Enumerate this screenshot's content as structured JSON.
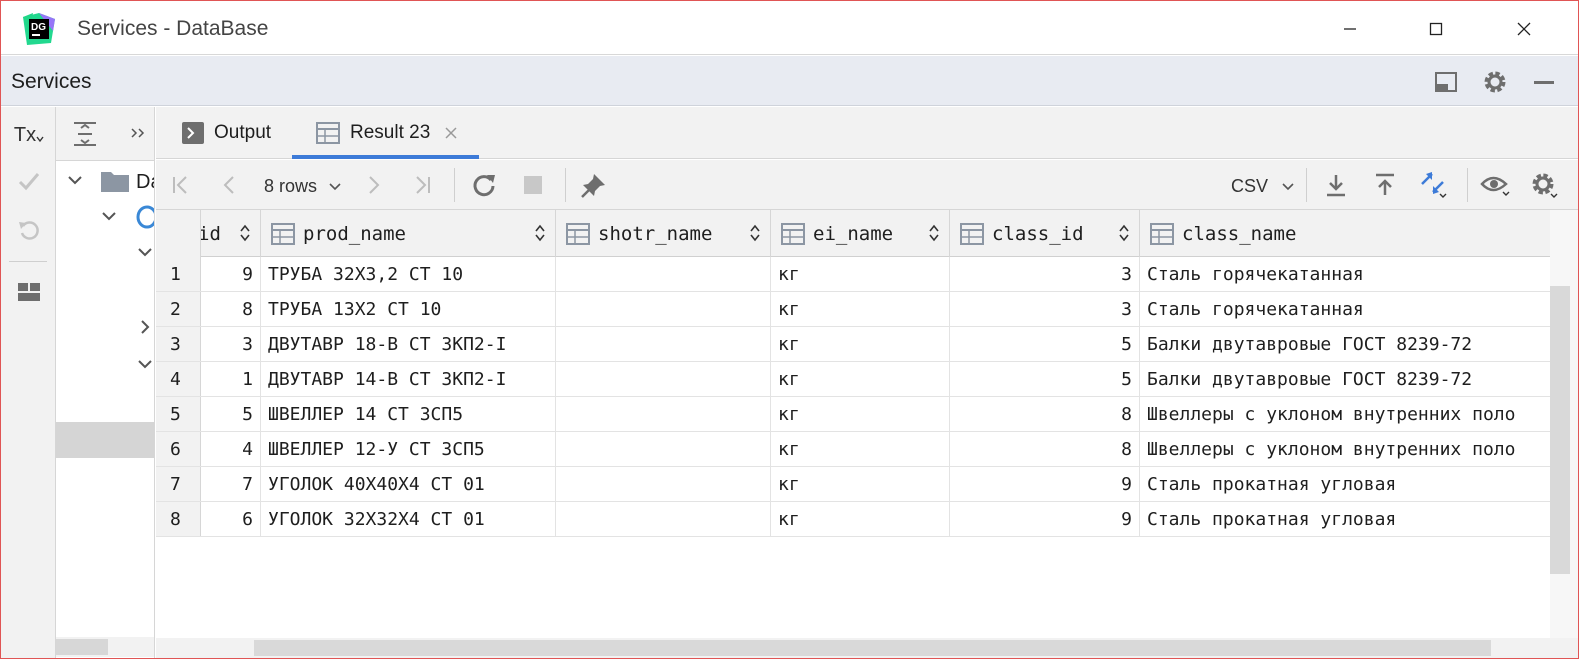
{
  "window": {
    "title": "Services - DataBase",
    "app_logo_text": "DG"
  },
  "services": {
    "title": "Services"
  },
  "tree": {
    "item_label": "Da"
  },
  "left_tools": {
    "tx_label": "Tx"
  },
  "tabs": [
    {
      "label": "Output"
    },
    {
      "label": "Result 23"
    }
  ],
  "toolbar": {
    "rows_label": "8 rows",
    "export_format": "CSV"
  },
  "grid": {
    "columns": [
      "id",
      "prod_name",
      "shotr_name",
      "ei_name",
      "class_id",
      "class_name"
    ],
    "rows": [
      {
        "n": "1",
        "id": "9",
        "prod_name": "ТРУБА 32Х3,2 СТ 10",
        "shotr_name": "",
        "ei_name": "кг",
        "class_id": "3",
        "class_name": "Сталь горячекатанная"
      },
      {
        "n": "2",
        "id": "8",
        "prod_name": "ТРУБА 13Х2 СТ 10",
        "shotr_name": "",
        "ei_name": "кг",
        "class_id": "3",
        "class_name": "Сталь горячекатанная"
      },
      {
        "n": "3",
        "id": "3",
        "prod_name": "ДВУТАВР 18-В СТ 3КП2-I",
        "shotr_name": "",
        "ei_name": "кг",
        "class_id": "5",
        "class_name": "Балки двутавровые ГОСТ 8239-72"
      },
      {
        "n": "4",
        "id": "1",
        "prod_name": "ДВУТАВР 14-В СТ 3КП2-I",
        "shotr_name": "",
        "ei_name": "кг",
        "class_id": "5",
        "class_name": "Балки двутавровые ГОСТ 8239-72"
      },
      {
        "n": "5",
        "id": "5",
        "prod_name": "ШВЕЛЛЕР 14 СТ 3СП5",
        "shotr_name": "",
        "ei_name": "кг",
        "class_id": "8",
        "class_name": "Швеллеры с уклоном внутренних поло"
      },
      {
        "n": "6",
        "id": "4",
        "prod_name": "ШВЕЛЛЕР 12-У СТ 3СП5",
        "shotr_name": "",
        "ei_name": "кг",
        "class_id": "8",
        "class_name": "Швеллеры с уклоном внутренних поло"
      },
      {
        "n": "7",
        "id": "7",
        "prod_name": "УГОЛОК 40Х40Х4 СТ 01",
        "shotr_name": "",
        "ei_name": "кг",
        "class_id": "9",
        "class_name": "Сталь прокатная угловая"
      },
      {
        "n": "8",
        "id": "6",
        "prod_name": "УГОЛОК 32Х32Х4 СТ 01",
        "shotr_name": "",
        "ei_name": "кг",
        "class_id": "9",
        "class_name": "Сталь прокатная угловая"
      }
    ]
  },
  "colors": {
    "accent": "#3d7bd8",
    "header_bg": "#e8ebf2",
    "panel_bg": "#f2f2f2",
    "icon_gray": "#6e6e6e"
  }
}
